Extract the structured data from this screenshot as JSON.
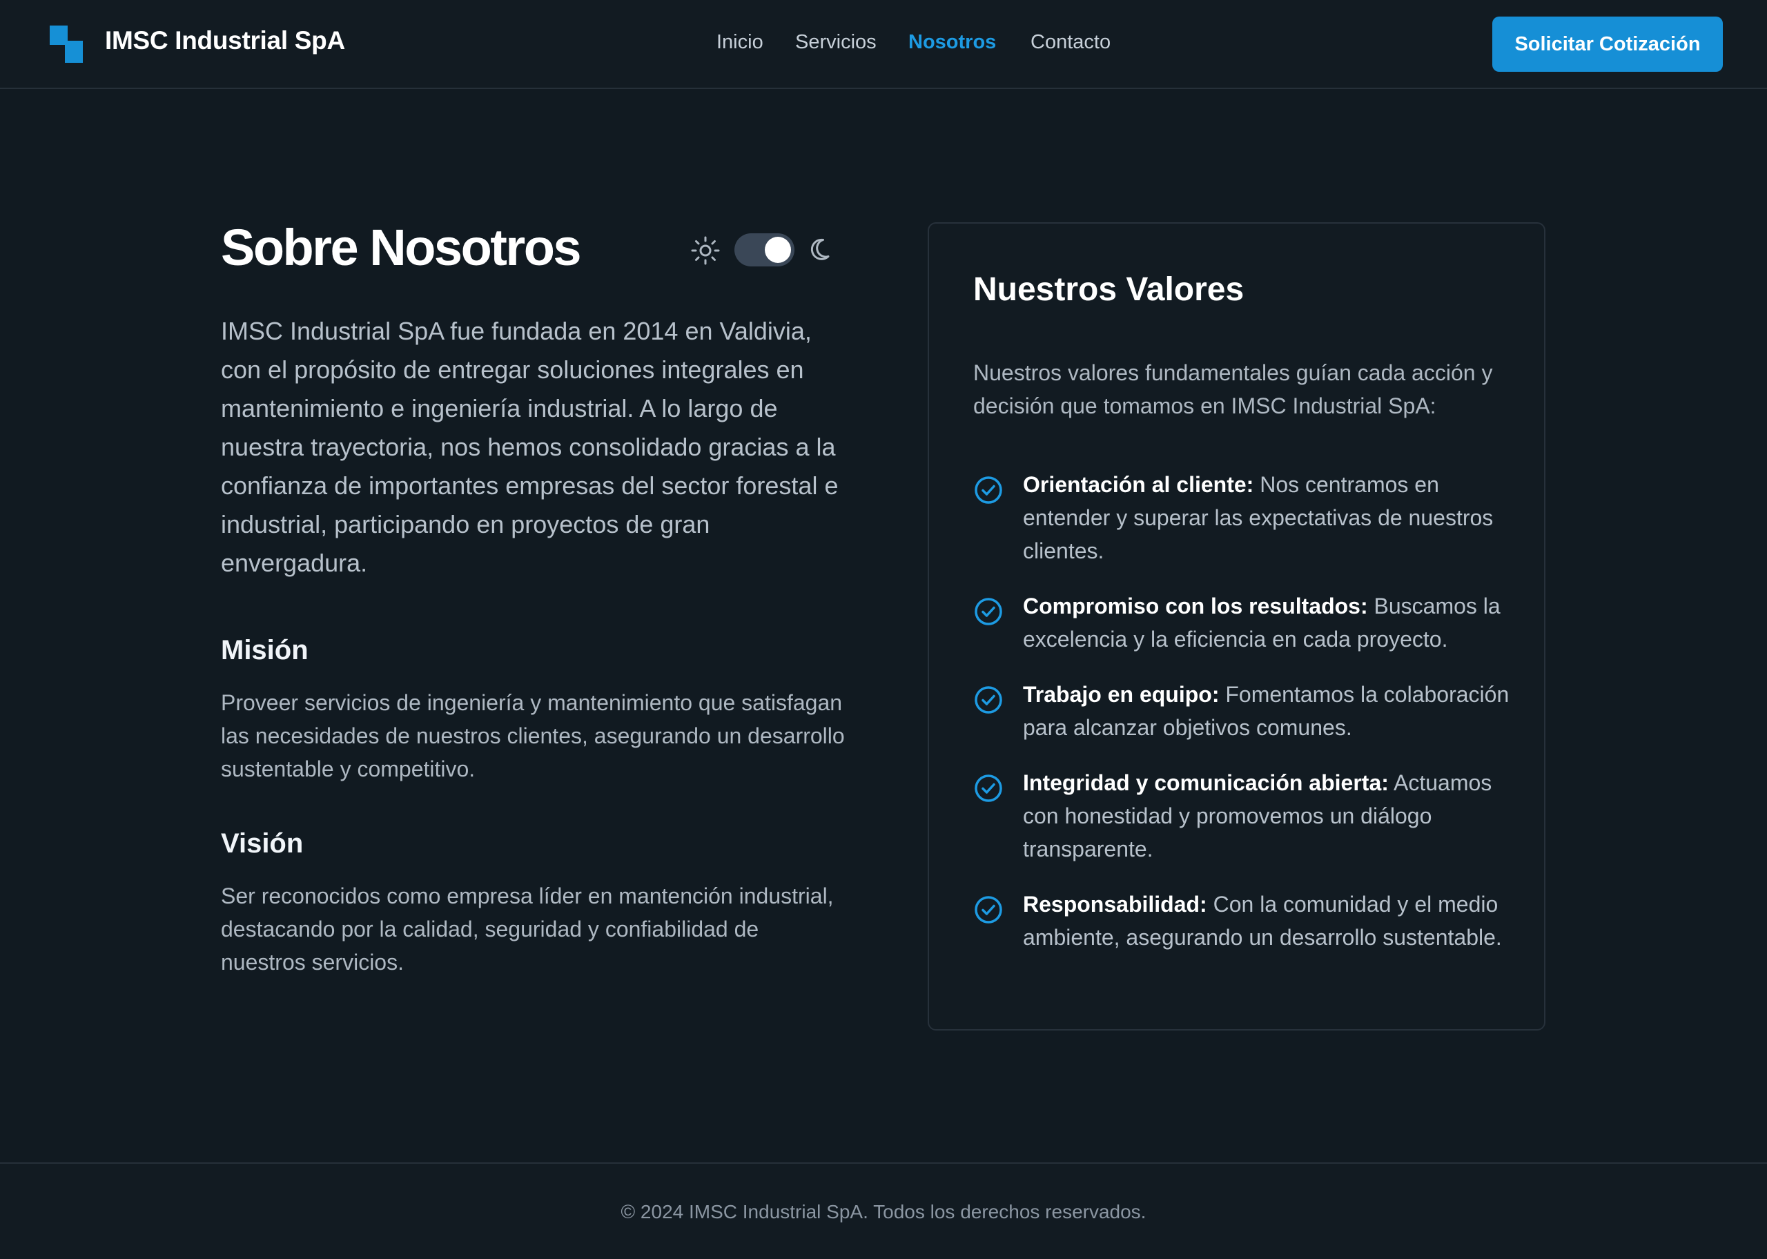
{
  "header": {
    "brand": "IMSC Industrial SpA",
    "nav": [
      "Inicio",
      "Servicios",
      "Nosotros",
      "Contacto"
    ],
    "active_nav": "Nosotros",
    "cta_label": "Solicitar Cotización"
  },
  "about": {
    "title": "Sobre Nosotros",
    "theme": {
      "dark_mode": true,
      "icons": [
        "sun-icon",
        "moon-icon"
      ]
    },
    "intro": "IMSC Industrial SpA fue fundada en 2014 en Valdivia, con el propósito de entregar soluciones integrales en mantenimiento e ingeniería industrial. A lo largo de nuestra trayectoria, nos hemos consolidado gracias a la confianza de importantes empresas del sector forestal e industrial, participando en proyectos de gran envergadura.",
    "mission_title": "Misión",
    "mission_text": "Proveer servicios de ingeniería y mantenimiento que satisfagan las necesidades de nuestros clientes, asegurando un desarrollo sustentable y competitivo.",
    "vision_title": "Visión",
    "vision_text": "Ser reconocidos como empresa líder en mantención industrial, destacando por la calidad, seguridad y confiabilidad de nuestros servicios."
  },
  "values": {
    "title": "Nuestros Valores",
    "intro": "Nuestros valores fundamentales guían cada acción y decisión que tomamos en IMSC Industrial SpA:",
    "items": [
      {
        "label": "Orientación al cliente:",
        "text": "Nos centramos en entender y superar las expectativas de nuestros clientes."
      },
      {
        "label": "Compromiso con los resultados:",
        "text": "Buscamos la excelencia y la eficiencia en cada proyecto."
      },
      {
        "label": "Trabajo en equipo:",
        "text": "Fomentamos la colaboración para alcanzar objetivos comunes."
      },
      {
        "label": "Integridad y comunicación abierta:",
        "text": "Actuamos con honestidad y promovemos un diálogo transparente."
      },
      {
        "label": "Responsabilidad:",
        "text": "Con la comunidad y el medio ambiente, asegurando un desarrollo sustentable."
      }
    ]
  },
  "footer": {
    "text": "© 2024 IMSC Industrial SpA. Todos los derechos reservados."
  },
  "colors": {
    "background": "#111a21",
    "accent": "#168fd6",
    "text_primary": "#ffffff",
    "text_muted": "#aeb8c2"
  }
}
